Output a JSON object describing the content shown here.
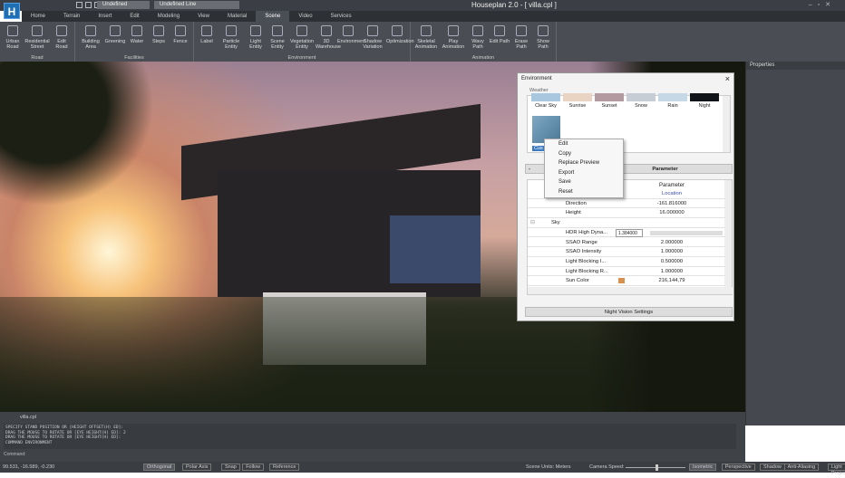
{
  "app": {
    "title": "Houseplan 2.0 -  [ villa.cpl ]",
    "logo": "H",
    "layer_combo": "Undefined",
    "linetype_combo": "Undefined Line"
  },
  "tabs": [
    "Home",
    "Terrain",
    "Insert",
    "Edit",
    "Modeling",
    "View",
    "Material",
    "Scene",
    "Video",
    "Services"
  ],
  "ribbon": [
    {
      "group": "Road",
      "buttons": [
        "Urban Road",
        "Residential Street",
        "Edit Road"
      ]
    },
    {
      "group": "Facilities",
      "buttons": [
        "Building Area",
        "Greening",
        "Water",
        "Steps",
        "Fence"
      ]
    },
    {
      "group": "Environment",
      "buttons": [
        "Label",
        "Particle Entity",
        "Light Entity",
        "Scene Entity",
        "Vegetation Entity",
        "3D Warehouse",
        "Environment",
        "Shadow Variation",
        "Optimization"
      ]
    },
    {
      "group": "Animation",
      "buttons": [
        "Skeletal Animation",
        "Play Animation",
        "Wavy Path",
        "Edit Path",
        "Erase Path",
        "Show Path"
      ]
    }
  ],
  "properties": {
    "title": "Properties"
  },
  "environment": {
    "title": "Environment",
    "weather_label": "Weather",
    "weather": [
      "Clear Sky",
      "Sunrise",
      "Sunset",
      "Snow",
      "Rain",
      "Night"
    ],
    "weather_colors": [
      "#a9c8e0",
      "#e9d4c4",
      "#b39aa0",
      "#c7cdd4",
      "#c6d7e6",
      "#111418"
    ],
    "custom_label": "Cus",
    "parameter_section": "Parameter",
    "parameter_header": "Parameter",
    "rows": [
      {
        "key": "Location",
        "value": "Location"
      },
      {
        "key": "Direction",
        "value": "-161.816000"
      },
      {
        "key": "Height",
        "value": "16.000000"
      },
      {
        "section": "Sky"
      },
      {
        "key": "HDR High Dyna...",
        "value": "1.384000"
      },
      {
        "key": "SSAO Range",
        "value": "2.000000"
      },
      {
        "key": "SSAO Intensity",
        "value": "1.000000"
      },
      {
        "key": "Light Blocking I...",
        "value": "0.500000"
      },
      {
        "key": "Light Blocking R...",
        "value": "1.000000"
      },
      {
        "key": "Sun Color",
        "value": "216,144,79"
      }
    ],
    "night_vision": "Night Vision Settings",
    "sun_color": "#d8904f"
  },
  "context_menu": [
    "Edit",
    "Copy",
    "Replace Preview",
    "Export",
    "Save",
    "Reset"
  ],
  "bottom": {
    "file_tab": "villa.cpl",
    "log": [
      "SPECIFY STAND POSITION OR [HEIGHT OFFSET(H) ED]:",
      "DRAG THE MOUSE TO ROTATE OR [EYE HEIGHT(H) ED]: 2",
      "DRAG THE MOUSE TO ROTATE OR [EYE HEIGHT(H) ED]:",
      "COMMAND ENVIRONMENT"
    ],
    "command_label": "Command:"
  },
  "status": {
    "coords": "99.531, -16.589, -0.230",
    "toggles": [
      "Orthogonal",
      "Polar Axis",
      "Snap",
      "Follow",
      "Reference"
    ],
    "units": "Scene Units: Meters",
    "camera_speed": "Camera Speed:",
    "camera_speed_value": 0.5,
    "views": [
      "Isometric",
      "Perspective",
      "Shadow",
      "Anti-Aliasing",
      "Light Projection"
    ]
  }
}
